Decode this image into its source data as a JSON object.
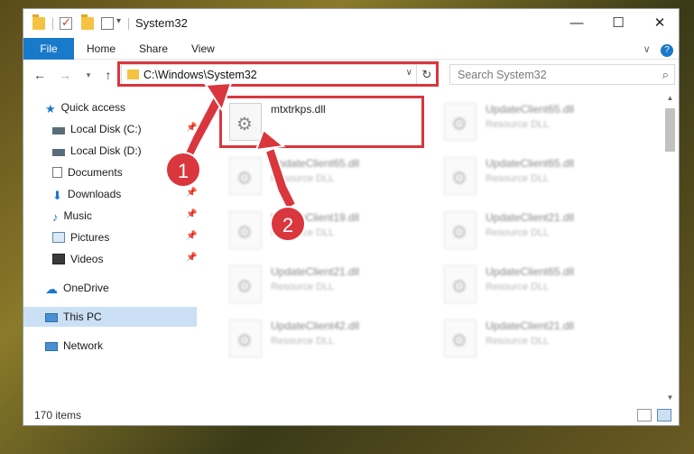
{
  "window": {
    "title": "System32"
  },
  "titlebar": {
    "min_symbol": "—",
    "max_symbol": "☐",
    "close_symbol": "✕",
    "dropdown_symbol": "▾"
  },
  "ribbon": {
    "tabs": [
      {
        "label": "File"
      },
      {
        "label": "Home"
      },
      {
        "label": "Share"
      },
      {
        "label": "View"
      }
    ],
    "expand_symbol": "∨",
    "help_symbol": "?"
  },
  "nav": {
    "back_symbol": "←",
    "forward_symbol": "→",
    "recent_symbol": "▾",
    "up_symbol": "↑",
    "address": "C:\\Windows\\System32",
    "address_dd_symbol": "∨",
    "refresh_symbol": "↻",
    "search_placeholder": "Search System32",
    "search_icon": "⌕"
  },
  "sidebar": {
    "items": [
      {
        "label": "Quick access",
        "icon": "star-icon",
        "pinned": false
      },
      {
        "label": "Local Disk (C:)",
        "icon": "drive-icon",
        "pinned": true
      },
      {
        "label": "Local Disk (D:)",
        "icon": "drive-icon",
        "pinned": false
      },
      {
        "label": "Documents",
        "icon": "documents-icon",
        "pinned": true
      },
      {
        "label": "Downloads",
        "icon": "downloads-icon",
        "pinned": true
      },
      {
        "label": "Music",
        "icon": "music-icon",
        "pinned": true
      },
      {
        "label": "Pictures",
        "icon": "pictures-icon",
        "pinned": true
      },
      {
        "label": "Videos",
        "icon": "videos-icon",
        "pinned": true
      },
      {
        "label": "OneDrive",
        "icon": "onedrive-icon",
        "pinned": false
      },
      {
        "label": "This PC",
        "icon": "pc-icon",
        "pinned": false,
        "selected": true
      },
      {
        "label": "Network",
        "icon": "network-icon",
        "pinned": false
      }
    ]
  },
  "files": [
    {
      "name": "mtxtrkps.dll",
      "type": "",
      "highlighted": true
    },
    {
      "name": "UpdateClient65.dll",
      "type": "Resource DLL"
    },
    {
      "name": "UpdateClient65.dll",
      "type": "Resource DLL"
    },
    {
      "name": "UpdateClient65.dll",
      "type": "Resource DLL"
    },
    {
      "name": "UpdateClient19.dll",
      "type": "Resource DLL"
    },
    {
      "name": "UpdateClient21.dll",
      "type": "Resource DLL"
    },
    {
      "name": "UpdateClient21.dll",
      "type": "Resource DLL"
    },
    {
      "name": "UpdateClient65.dll",
      "type": "Resource DLL"
    },
    {
      "name": "UpdateClient42.dll",
      "type": "Resource DLL"
    },
    {
      "name": "UpdateClient21.dll",
      "type": "Resource DLL"
    }
  ],
  "status": {
    "count_text": "170 items"
  },
  "annotations": {
    "badge1": "1",
    "badge2": "2"
  },
  "colors": {
    "accent": "#1979ca",
    "highlight_red": "#d9363e",
    "selected": "#cce0f5"
  }
}
